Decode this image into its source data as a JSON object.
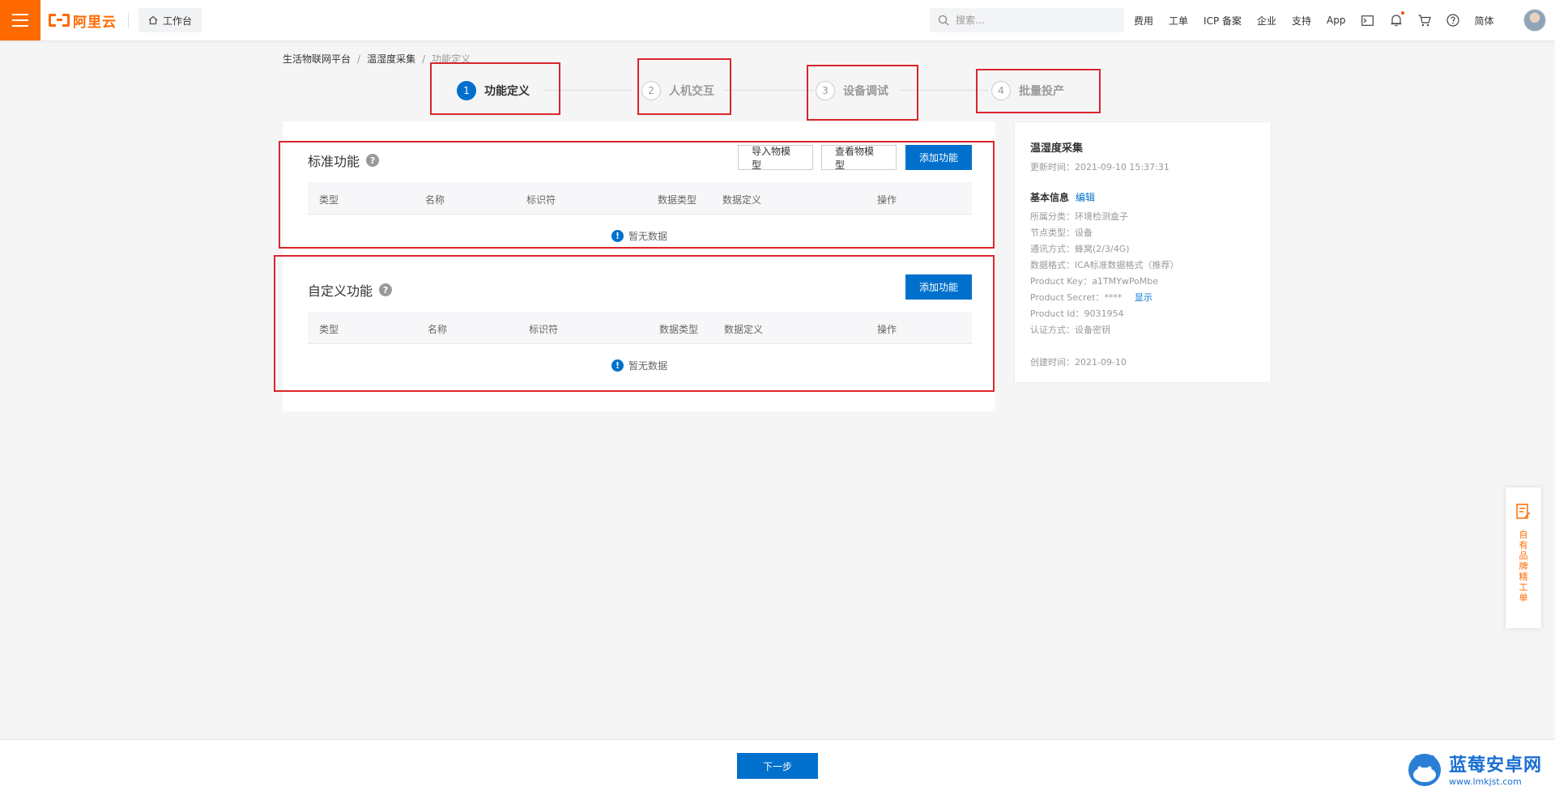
{
  "colors": {
    "brand": "#ff6a00",
    "primary": "#0070cc",
    "annotation": "#d9262c"
  },
  "topbar": {
    "logo_text": "阿里云",
    "workbench_label": "工作台",
    "search_placeholder": "搜索...",
    "nav": [
      "费用",
      "工单",
      "ICP 备案",
      "企业",
      "支持",
      "App"
    ],
    "lang_label": "简体",
    "icons": [
      "terminal-icon",
      "bell-icon",
      "cart-icon",
      "help-circle-icon"
    ]
  },
  "breadcrumb": [
    "生活物联网平台",
    "温湿度采集",
    "功能定义"
  ],
  "steps": [
    {
      "num": "1",
      "label": "功能定义"
    },
    {
      "num": "2",
      "label": "人机交互"
    },
    {
      "num": "3",
      "label": "设备调试"
    },
    {
      "num": "4",
      "label": "批量投产"
    }
  ],
  "standard": {
    "title": "标准功能",
    "buttons": {
      "import": "导入物模型",
      "view": "查看物模型",
      "add": "添加功能"
    },
    "columns": [
      "类型",
      "名称",
      "标识符",
      "数据类型",
      "数据定义",
      "操作"
    ],
    "empty_text": "暂无数据"
  },
  "custom": {
    "title": "自定义功能",
    "add_button": "添加功能",
    "columns": [
      "类型",
      "名称",
      "标识符",
      "数据类型",
      "数据定义",
      "操作"
    ],
    "empty_text": "暂无数据"
  },
  "product": {
    "name": "温湿度采集",
    "updated": "更新时间：2021-09-10 15:37:31",
    "basic_info_label": "基本信息",
    "edit_label": "编辑",
    "category": "所属分类：环境检测盒子",
    "node_type": "节点类型：设备",
    "comm": "通讯方式：蜂窝(2/3/4G)",
    "data_format": "数据格式：ICA标准数据格式（推荐）",
    "product_key": "Product Key：a1TMYwPoMbe",
    "product_secret": "Product Secret：****",
    "show_label": "显示",
    "product_id": "Product Id：9031954",
    "auth": "认证方式：设备密钥",
    "created": "创建时间：2021-09-10"
  },
  "footer": {
    "next_label": "下一步"
  },
  "float_ticket": {
    "label": "自有品牌精工单"
  },
  "watermark": {
    "title": "蓝莓安卓网",
    "url": "www.lmkjst.com"
  }
}
